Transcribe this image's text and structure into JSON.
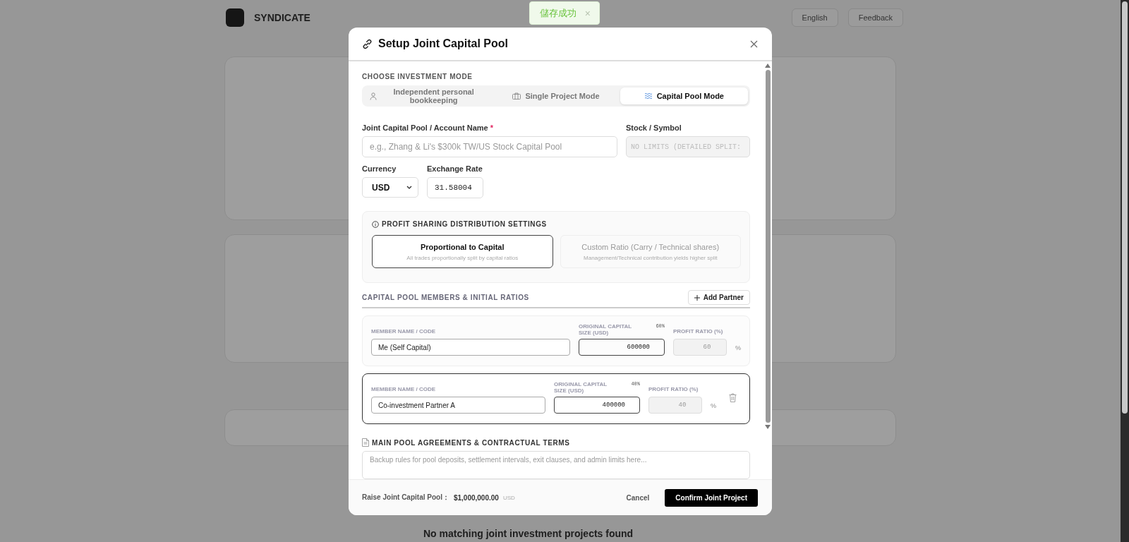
{
  "background": {
    "brand": "SYNDICATE",
    "language": "English",
    "feedback": "Feedback",
    "empty_message": "No matching joint investment projects found"
  },
  "toast": {
    "message": "儲存成功",
    "close": "×"
  },
  "dialog": {
    "title": "Setup Joint Capital Pool",
    "mode_heading": "CHOOSE INVESTMENT MODE",
    "modes": [
      {
        "label": "Independent personal bookkeeping",
        "kind": "person",
        "selected": false
      },
      {
        "label": "Single Project Mode",
        "kind": "briefcase",
        "selected": false
      },
      {
        "label": "Capital Pool Mode",
        "kind": "waves",
        "selected": true
      }
    ],
    "name_field": {
      "label": "Joint Capital Pool / Account Name",
      "required": "*",
      "placeholder": "e.g., Zhang & Li's $300k TW/US Stock Capital Pool"
    },
    "symbol_field": {
      "label": "Stock / Symbol",
      "placeholder": "NO LIMITS (DETAILED SPLIT:",
      "disabled": true
    },
    "currency_field": {
      "label": "Currency",
      "value": "USD"
    },
    "rate_field": {
      "label": "Exchange Rate",
      "value": "31.58004"
    },
    "profit_sharing": {
      "heading": "PROFIT SHARING DISTRIBUTION SETTINGS",
      "options": [
        {
          "title": "Proportional to Capital",
          "subtitle": "All trades proportionally split by capital ratios",
          "selected": true
        },
        {
          "title": "Custom Ratio (Carry / Technical shares)",
          "subtitle": "Management/Technical contribution yields higher split",
          "selected": false
        }
      ]
    },
    "members_heading": "CAPITAL POOL MEMBERS & INITIAL RATIOS",
    "add_button": "Add Partner",
    "members": [
      {
        "name_label": "MEMBER NAME / CODE",
        "name": "Me (Self Capital)",
        "capital_label": "ORIGINAL CAPITAL SIZE (USD)",
        "share": "60%",
        "capital": "600000",
        "ratio_label": "PROFIT RATIO (%)",
        "ratio": "60",
        "unit": "%",
        "removable": false,
        "active": false
      },
      {
        "name_label": "MEMBER NAME / CODE",
        "name": "Co-investment Partner A",
        "capital_label": "ORIGINAL CAPITAL SIZE (USD)",
        "share": "40%",
        "capital": "400000",
        "ratio_label": "PROFIT RATIO (%)",
        "ratio": "40",
        "unit": "%",
        "removable": true,
        "active": true
      }
    ],
    "agreements": {
      "heading": "MAIN POOL AGREEMENTS & CONTRACTUAL TERMS",
      "placeholder": "Backup rules for pool deposits, settlement intervals, exit clauses, and admin limits here..."
    },
    "footer": {
      "total_label": "Raise Joint Capital Pool：",
      "total": "$1,000,000.00",
      "currency": "USD",
      "cancel": "Cancel",
      "confirm": "Confirm Joint Project"
    }
  }
}
